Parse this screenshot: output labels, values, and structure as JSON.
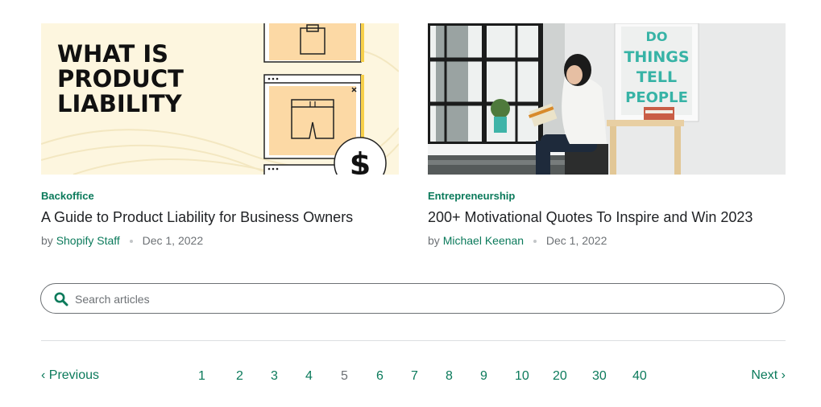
{
  "articles": [
    {
      "category": "Backoffice",
      "title": "A Guide to Product Liability for Business Owners",
      "by": "by",
      "author": "Shopify Staff",
      "date": "Dec 1, 2022",
      "image_text": [
        "WHAT IS",
        "PRODUCT",
        "LIABILITY"
      ]
    },
    {
      "category": "Entrepreneurship",
      "title": "200+ Motivational Quotes To Inspire and Win 2023",
      "by": "by",
      "author": "Michael Keenan",
      "date": "Dec 1, 2022",
      "poster_text": [
        "DO",
        "THINGS",
        "TELL",
        "PEOPLE"
      ]
    }
  ],
  "search": {
    "placeholder": "Search articles",
    "value": ""
  },
  "pagination": {
    "prev": "‹ Previous",
    "next": "Next ›",
    "pages": [
      "1",
      "2",
      "3",
      "4",
      "5",
      "6",
      "7",
      "8",
      "9",
      "10",
      "20",
      "30",
      "40"
    ]
  },
  "colors": {
    "accent": "#0b7a5b",
    "text": "#212326",
    "muted": "#6d7175"
  }
}
